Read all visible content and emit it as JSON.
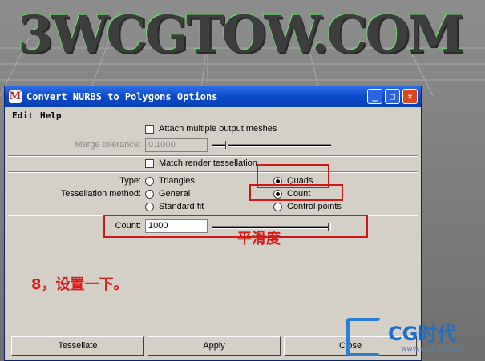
{
  "viewport": {
    "scene_text": "3WCGTOW.COM"
  },
  "dialog": {
    "title": "Convert NURBS to Polygons Options",
    "window_buttons": {
      "minimize": "_",
      "maximize": "□",
      "close": "✕"
    },
    "menu": [
      "Edit",
      "Help"
    ],
    "attach_multiple_label": "Attach multiple output meshes",
    "merge_tolerance": {
      "label": "Merge tolerance:",
      "value": "0.1000"
    },
    "match_render_label": "Match render tessellation",
    "type": {
      "label": "Type:",
      "options": [
        "Triangles",
        "Quads"
      ],
      "selected": "Quads"
    },
    "tessellation_method": {
      "label": "Tessellation method:",
      "options": [
        "General",
        "Count",
        "Standard fit",
        "Control points"
      ],
      "selected": "Count"
    },
    "count": {
      "label": "Count:",
      "value": "1000"
    },
    "buttons": {
      "tessellate": "Tessellate",
      "apply": "Apply",
      "close": "Close"
    }
  },
  "annotations": {
    "smoothness": "平滑度",
    "step_note": "8，设置一下。"
  },
  "watermark": {
    "brand": "CG时代",
    "url": "www.cgtimes.com"
  },
  "colors": {
    "title_bar": "#0b49c8",
    "annotation_red": "#d01818",
    "dialog_bg": "#d4d0c8"
  }
}
